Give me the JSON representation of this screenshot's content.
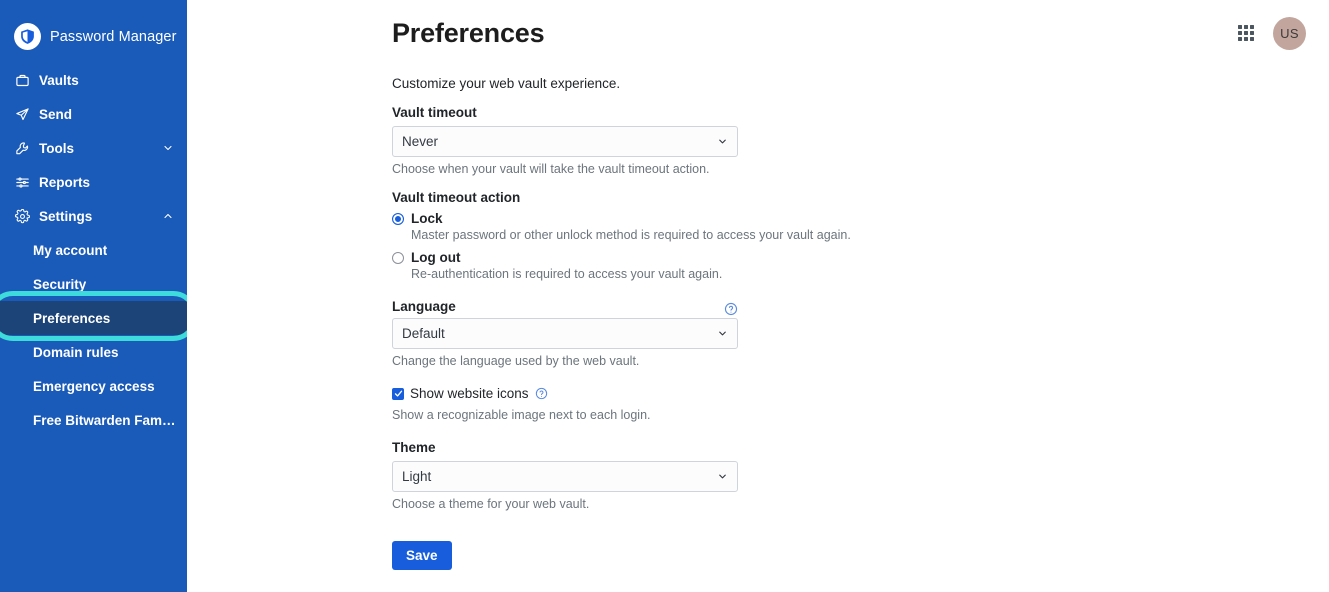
{
  "brand": {
    "name": "Password Manager",
    "logo_icon": "bitwarden-shield-icon"
  },
  "sidebar": {
    "background_color": "#1a5ab8",
    "active_item_color": "#1c4478",
    "highlight_ring_color": "#3ddbdb",
    "items": [
      {
        "label": "Vaults",
        "icon": "vault-icon",
        "chevron": ""
      },
      {
        "label": "Send",
        "icon": "send-paper-plane-icon",
        "chevron": ""
      },
      {
        "label": "Tools",
        "icon": "wrench-icon",
        "chevron": "chevron-down-icon"
      },
      {
        "label": "Reports",
        "icon": "sliders-icon",
        "chevron": ""
      },
      {
        "label": "Settings",
        "icon": "gear-icon",
        "chevron": "chevron-up-icon"
      }
    ],
    "settings_subitems": [
      {
        "label": "My account",
        "active": false
      },
      {
        "label": "Security",
        "active": false
      },
      {
        "label": "Preferences",
        "active": true
      },
      {
        "label": "Domain rules",
        "active": false
      },
      {
        "label": "Emergency access",
        "active": false
      },
      {
        "label": "Free Bitwarden Famil…",
        "active": false
      }
    ]
  },
  "topbar": {
    "grid_icon": "app-grid-icon",
    "avatar_initials": "US",
    "avatar_color": "#c2a59c"
  },
  "page": {
    "title": "Preferences",
    "intro": "Customize your web vault experience."
  },
  "vault_timeout": {
    "label": "Vault timeout",
    "value": "Never",
    "hint": "Choose when your vault will take the vault timeout action.",
    "options": [
      "Never"
    ]
  },
  "vault_timeout_action": {
    "label": "Vault timeout action",
    "options": [
      {
        "label": "Lock",
        "description": "Master password or other unlock method is required to access your vault again.",
        "selected": true
      },
      {
        "label": "Log out",
        "description": "Re-authentication is required to access your vault again.",
        "selected": false
      }
    ]
  },
  "language": {
    "label": "Language",
    "value": "Default",
    "hint": "Change the language used by the web vault.",
    "help_icon": "help-circle-icon",
    "options": [
      "Default"
    ]
  },
  "show_website_icons": {
    "label": "Show website icons",
    "checked": true,
    "hint": "Show a recognizable image next to each login.",
    "help_icon": "help-circle-icon"
  },
  "theme": {
    "label": "Theme",
    "value": "Light",
    "hint": "Choose a theme for your web vault.",
    "options": [
      "Light"
    ]
  },
  "actions": {
    "save_label": "Save",
    "save_color": "#175ddc"
  }
}
